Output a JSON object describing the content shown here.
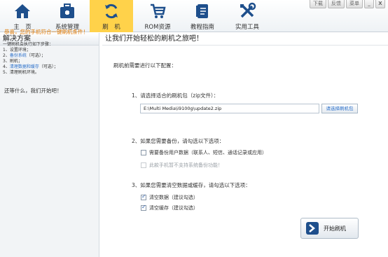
{
  "nav": {
    "items": [
      {
        "label": "主　页",
        "icon": "home-icon"
      },
      {
        "label": "系统管理",
        "icon": "toolbox-icon"
      },
      {
        "label": "刷　机",
        "icon": "refresh-icon"
      },
      {
        "label": "ROM资源",
        "icon": "cart-icon"
      },
      {
        "label": "教程指南",
        "icon": "book-icon"
      },
      {
        "label": "实用工具",
        "icon": "tools-icon"
      }
    ],
    "active_index": 2
  },
  "window": {
    "download": "下载",
    "feedback": "反馈",
    "menu": "菜单",
    "minimize": "_",
    "close": "X"
  },
  "left": {
    "title": "解决方案",
    "congrats": "恭喜，您的手机符合一键刷机条件！",
    "steps_intro": "一键刷机会执行如下步骤：",
    "step1": "1、设置环境；",
    "step2_prefix": "2、",
    "step2_link": "备份系统",
    "step2_suffix": "（可选）；",
    "step3": "3、刷机；",
    "step4_prefix": "4、",
    "step4_link": "清理数据和缓存",
    "step4_suffix": "（可选）；",
    "step5": "5、清理刷机环境。",
    "go": "还等什么，我们开始吧！"
  },
  "main": {
    "title": "让我们开始轻松的刷机之旅吧！",
    "intro": "刷机前需要进行以下配置：",
    "step1": "1、请选择适合的刷机包（zip文件）：",
    "zip_path": "E:\\Multi Media\\i9100g\\update2.zip",
    "pick_button": "请选择刷机包",
    "step2": "2、如果您需要备份，请勾选以下选项：",
    "backup_option": "需要备份用户数据（联系人、短信、通话记录或应用）",
    "backup_disabled": "此款手机暂不支持系统备份功能！",
    "step3": "3、如果您需要清空数据或缓存，请勾选以下选项：",
    "clear_data": "清空数据（建议勾选）",
    "clear_cache": "清空缓存（建议勾选）",
    "start_button": "开始刷机"
  },
  "colors": {
    "active_tab": "#ffd24a",
    "link_blue": "#2a6fc9",
    "congrats_orange": "#e07800",
    "brand_navy": "#1e4f8c"
  }
}
